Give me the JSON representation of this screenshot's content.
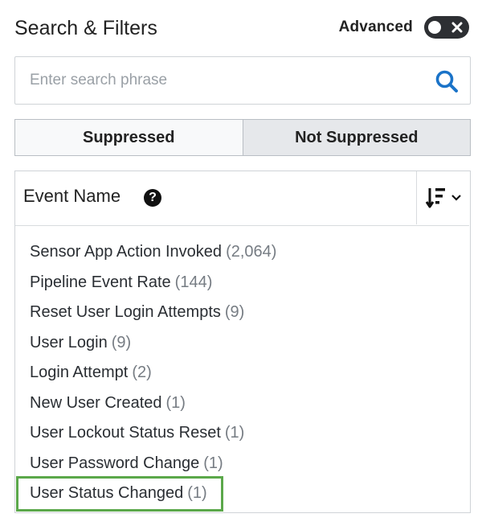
{
  "header": {
    "title": "Search & Filters",
    "advanced_label": "Advanced",
    "advanced_enabled": false
  },
  "search": {
    "value": "",
    "placeholder": "Enter search phrase",
    "icon": "search-icon",
    "accent_color": "#1a73c8"
  },
  "segments": [
    {
      "label": "Suppressed",
      "active": false
    },
    {
      "label": "Not Suppressed",
      "active": true
    }
  ],
  "panel": {
    "title": "Event Name",
    "help_glyph": "?",
    "sort_icon": "sort-descending-icon"
  },
  "events": [
    {
      "name": "Sensor App Action Invoked",
      "count": "(2,064)"
    },
    {
      "name": "Pipeline Event Rate",
      "count": "(144)"
    },
    {
      "name": "Reset User Login Attempts",
      "count": "(9)"
    },
    {
      "name": "User Login",
      "count": "(9)"
    },
    {
      "name": "Login Attempt",
      "count": "(2)"
    },
    {
      "name": "New User Created",
      "count": "(1)"
    },
    {
      "name": "User Lockout Status Reset",
      "count": "(1)"
    },
    {
      "name": "User Password Change",
      "count": "(1)"
    },
    {
      "name": "User Status Changed",
      "count": "(1)"
    }
  ],
  "highlight_color": "#5ba84a"
}
